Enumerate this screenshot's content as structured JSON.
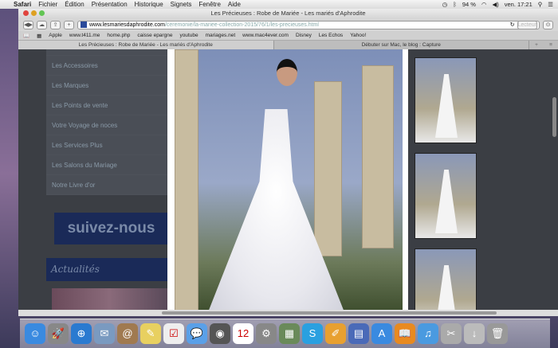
{
  "menubar": {
    "apple": "",
    "app": "Safari",
    "items": [
      "Fichier",
      "Édition",
      "Présentation",
      "Historique",
      "Signets",
      "Fenêtre",
      "Aide"
    ],
    "battery": "94 %",
    "clock": "ven. 17:21"
  },
  "window": {
    "title": "Les Précieuses : Robe de Mariée - Les mariés d'Aphrodite",
    "url_domain": "www.lesmariesdaphrodite.com",
    "url_path": "/ceremonie/la-mariee-collection-2015/76/1/les-precieuses.html",
    "reader": "Lecteur"
  },
  "bookmarks": [
    "Apple",
    "www.t411.me",
    "home.php",
    "caisse epargne",
    "youtube",
    "mariages.net",
    "www.mac4ever.com",
    "Disney",
    "Les Echos",
    "Yahoo!"
  ],
  "tabs": [
    "Les Précieuses : Robe de Mariée - Les mariés d'Aphrodite",
    "Débuter sur Mac, le blog : Capture"
  ],
  "nav": [
    "Les Accessoires",
    "Les Marques",
    "Les Points de vente",
    "Votre Voyage de noces",
    "Les Services Plus",
    "Les Salons du Mariage",
    "Notre Livre d'or"
  ],
  "follow": "suivez-nous",
  "actu": "Actualités",
  "dock": [
    {
      "n": "finder",
      "c": "#3a8ae0",
      "g": "☺"
    },
    {
      "n": "launchpad",
      "c": "#888",
      "g": "🚀"
    },
    {
      "n": "safari",
      "c": "#2a7ad0",
      "g": "⊕"
    },
    {
      "n": "mail",
      "c": "#7a9ac0",
      "g": "✉"
    },
    {
      "n": "contacts",
      "c": "#a07a50",
      "g": "@"
    },
    {
      "n": "notes",
      "c": "#e8d060",
      "g": "✎"
    },
    {
      "n": "reminders",
      "c": "#eee",
      "g": "☑"
    },
    {
      "n": "messages",
      "c": "#5aa0e8",
      "g": "💬"
    },
    {
      "n": "facetime",
      "c": "#555",
      "g": "◉"
    },
    {
      "n": "calendar",
      "c": "#fff",
      "g": "12"
    },
    {
      "n": "system-preferences",
      "c": "#888",
      "g": "⚙"
    },
    {
      "n": "photos",
      "c": "#6a8a5a",
      "g": "▦"
    },
    {
      "n": "skype",
      "c": "#2aa0e0",
      "g": "S"
    },
    {
      "n": "pages",
      "c": "#e8a030",
      "g": "✐"
    },
    {
      "n": "keynote",
      "c": "#4a6ab8",
      "g": "▤"
    },
    {
      "n": "app-store",
      "c": "#3a8ae0",
      "g": "A"
    },
    {
      "n": "ibooks",
      "c": "#e88a20",
      "g": "📖"
    },
    {
      "n": "itunes",
      "c": "#4a9ae0",
      "g": "♫"
    },
    {
      "n": "preview",
      "c": "#aaa",
      "g": "✂"
    },
    {
      "n": "downloads",
      "c": "#bbb",
      "g": "↓"
    },
    {
      "n": "trash",
      "c": "#999",
      "g": "🗑"
    }
  ]
}
